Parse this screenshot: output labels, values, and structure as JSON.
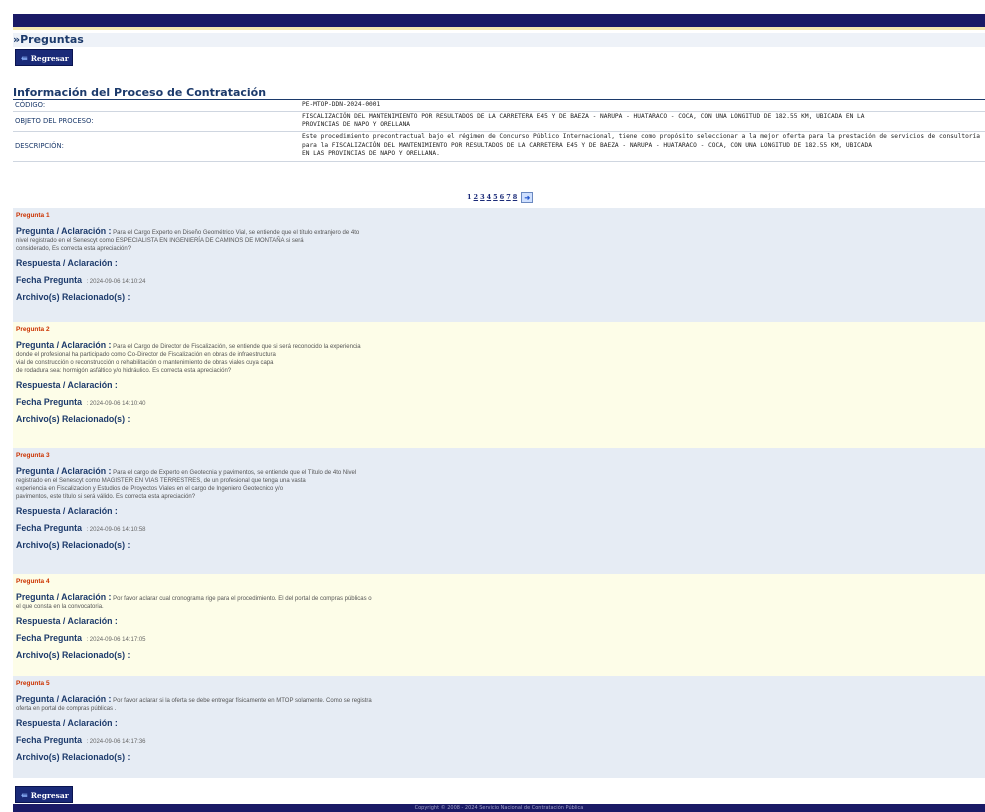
{
  "header": {
    "title": "»Preguntas"
  },
  "back_button": {
    "label": "Regresar"
  },
  "info": {
    "title": "Información del Proceso de Contratación",
    "rows": [
      {
        "label": "CÓDIGO:",
        "value": "PE-MTOP-DDN-2024-0001"
      },
      {
        "label": "OBJETO DEL PROCESO:",
        "value_lines": [
          "FISCALIZACIÓN DEL MANTENIMIENTO POR RESULTADOS DE LA CARRETERA E45 Y DE BAEZA - NARUPA - HUATARACO - COCA, CON UNA LONGITUD DE 182.55 KM, UBICADA EN LA",
          "PROVINCIAS DE NAPO Y ORELLANA"
        ]
      },
      {
        "label": "DESCRIPCIÓN:",
        "value_lines": [
          "Este procedimiento precontractual bajo el régimen de Concurso Público Internacional, tiene como propósito seleccionar a la mejor oferta para la prestación de servicios de consultoría",
          "para la FISCALIZACIÓN DEL MANTENIMIENTO POR RESULTADOS DE LA CARRETERA E45 Y DE BAEZA - NARUPA - HUATARACO - COCA, CON UNA LONGITUD DE 182.55 KM, UBICADA",
          "EN LAS PROVINCIAS DE NAPO Y ORELLANA."
        ]
      }
    ]
  },
  "pager": {
    "pages": [
      "1",
      "2",
      "3",
      "4",
      "5",
      "6",
      "7",
      "8"
    ],
    "current": "1"
  },
  "labels": {
    "pregunta": "Pregunta / Aclaración :",
    "respuesta": "Respuesta / Aclaración :",
    "fecha": "Fecha Pregunta",
    "archivos": "Archivo(s) Relacionado(s) :"
  },
  "questions": [
    {
      "title": "Pregunta 1",
      "lines": [
        "Para el Cargo Experto en Diseño Geométrico Vial, se entiende que el título extranjero de 4to",
        "nivel registrado en el Senescyt como ESPECIALISTA EN INGENIERÍA DE CAMINOS DE MONTAÑA si será",
        "considerado, Es correcta esta apreciación?"
      ],
      "date": ": 2024-09-06 14:10:24"
    },
    {
      "title": "Pregunta 2",
      "lines": [
        "Para el Cargo de Director de Fiscalización, se entiende que si será reconocido la experiencia",
        "donde el profesional ha participado como Co-Director de Fiscalización en obras de infraestructura",
        "vial de construcción o reconstrucción o rehabilitación o mantenimiento de obras viales cuya capa",
        "de rodadura sea: hormigón asfáltico y/o hidráulico. Es correcta esta apreciación?"
      ],
      "date": ": 2024-09-06 14:10:40"
    },
    {
      "title": "Pregunta 3",
      "lines": [
        "Para el cargo de Experto en Geotecnia y pavimentos, se entiende que el Título de 4to Nivel",
        "registrado en el Senescyt como MAGISTER EN VIAS TERRESTRES, de un profesional que tenga una vasta",
        "experiencia en Fiscalizacion y Estudios de Proyectos Viales en el cargo de Ingeniero Geotecnico y/o",
        "pavimentos, este título si será válido. Es correcta esta apreciación?"
      ],
      "date": ": 2024-09-06 14:10:58"
    },
    {
      "title": "Pregunta 4",
      "lines": [
        "Por favor aclarar cual cronograma rige para el procedimiento. El del portal de compras públicas o",
        "el que consta en la convocatoria."
      ],
      "date": ": 2024-09-06 14:17:05"
    },
    {
      "title": "Pregunta 5",
      "lines": [
        "Por favor aclarar si la oferta se debe entregar físicamente en MTOP solamente. Como se registra",
        "oferta en portal de compras públicas ."
      ],
      "date": ": 2024-09-06 14:17:36"
    }
  ],
  "footer": {
    "text": "Copyright © 2008 - 2024 Servicio Nacional de Contratación Pública"
  }
}
